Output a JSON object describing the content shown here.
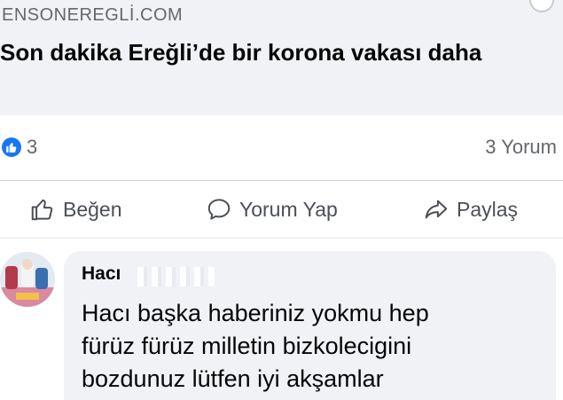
{
  "link_preview": {
    "domain": "ENSONEREGLİ.COM",
    "headline": "Son dakika Ereğli’de bir korona vakası daha"
  },
  "reactions": {
    "like_count": "3",
    "comment_count": "3 Yorum"
  },
  "actions": {
    "like_label": "Beğen",
    "comment_label": "Yorum Yap",
    "share_label": "Paylaş"
  },
  "comment": {
    "author": "Hacı",
    "text": "Hacı başka haberiniz yokmu hep\nfürüz fürüz milletin bizkolecigini\nbozdunuz lütfen  iyi akşamlar"
  },
  "colors": {
    "accent": "#1877f2",
    "card_bg": "#f0f2f5",
    "muted_text": "#65676b"
  },
  "icons": [
    "like-badge-icon",
    "thumbs-up-icon",
    "comment-icon",
    "share-icon"
  ]
}
